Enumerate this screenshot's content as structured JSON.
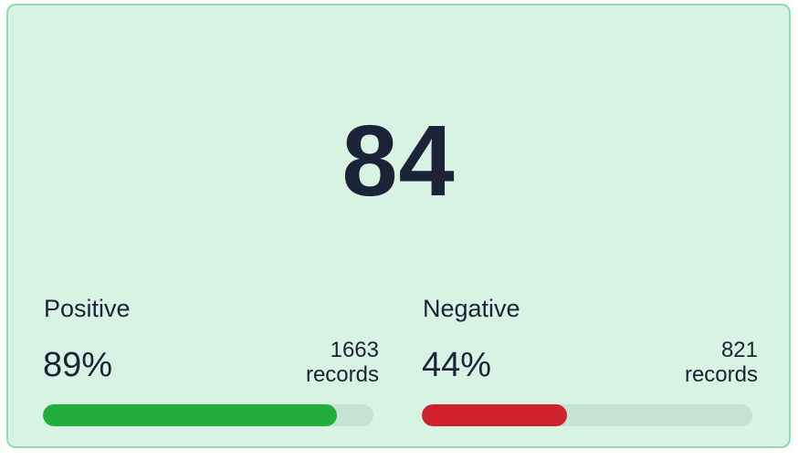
{
  "score": "84",
  "positive": {
    "label": "Positive",
    "percent_text": "89%",
    "percent": 89,
    "records_count": "1663",
    "records_unit": "records",
    "color": "#22ae3b"
  },
  "negative": {
    "label": "Negative",
    "percent_text": "44%",
    "percent": 44,
    "records_count": "821",
    "records_unit": "records",
    "color": "#d0212d"
  },
  "colors": {
    "card_background": "#d7f3e3",
    "card_border": "#8fdcad",
    "bar_track": "#c5e2d2",
    "text": "#1c2336"
  }
}
